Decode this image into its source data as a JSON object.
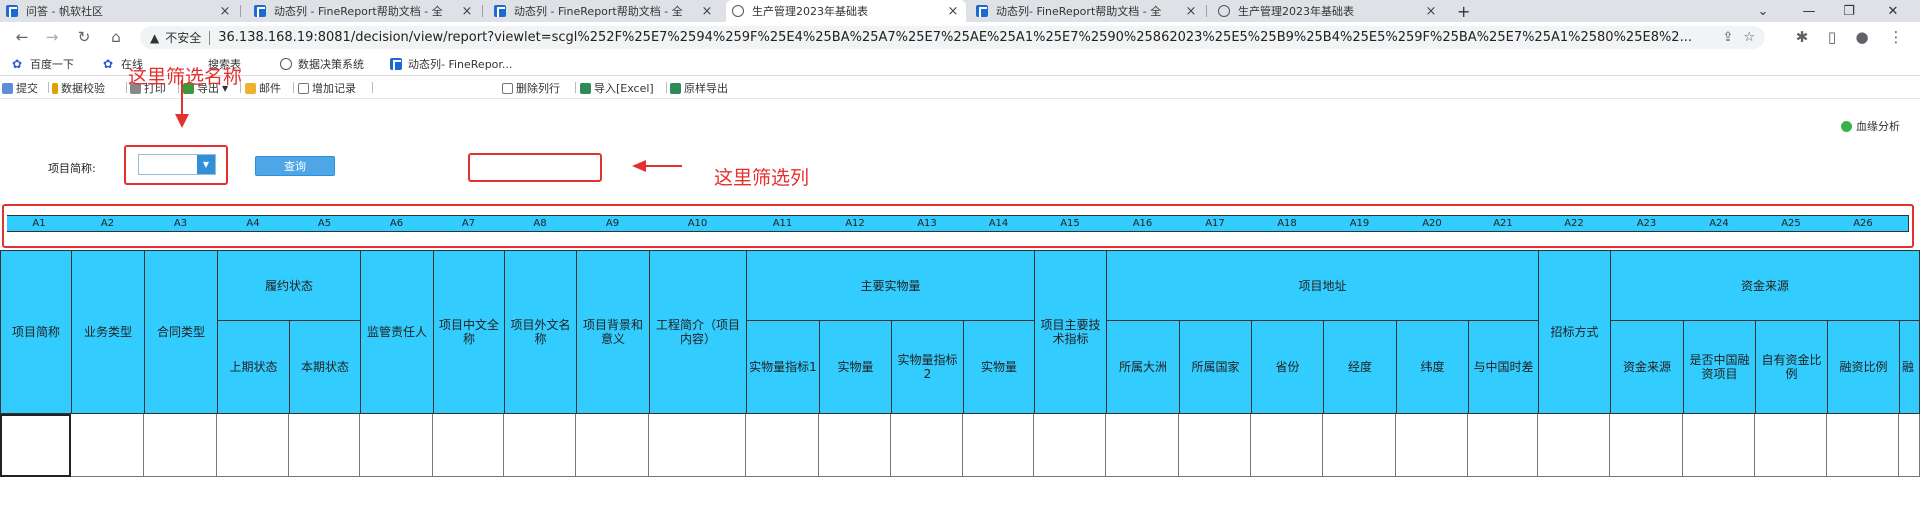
{
  "browser": {
    "tabs": [
      {
        "title": "问答 - 帆软社区",
        "icon": "finereport-icon",
        "active": false
      },
      {
        "title": "动态列 - FineReport帮助文档 - 全",
        "icon": "finereport-icon",
        "active": false
      },
      {
        "title": "动态列 - FineReport帮助文档 - 全",
        "icon": "finereport-icon",
        "active": false
      },
      {
        "title": "生产管理2023年基础表",
        "icon": "globe-icon",
        "active": true
      },
      {
        "title": "动态列- FineReport帮助文档 - 全",
        "icon": "finereport-icon",
        "active": false
      },
      {
        "title": "生产管理2023年基础表",
        "icon": "globe-icon",
        "active": false
      }
    ],
    "new_tab": "+",
    "security_label": "不安全",
    "url": "36.138.168.19:8081/decision/view/report?viewlet=scgl%252F%25E7%2594%259F%25E4%25BA%25A7%25E7%25AE%25A1%25E7%2590%25862023%25E5%25B9%25B4%25E5%259F%25BA%25E7%25A1%2580%25E8%2..."
  },
  "bookmarks": [
    {
      "label": "百度一下",
      "icon": "baidu-icon"
    },
    {
      "label": "在线",
      "icon": "baidu-icon"
    },
    {
      "label": "搜索表",
      "icon": "page-icon"
    },
    {
      "label": "数据决策系统",
      "icon": "globe-icon"
    },
    {
      "label": "动态列- FineRepor...",
      "icon": "finereport-icon"
    }
  ],
  "toolbar": {
    "items": [
      {
        "label": "提交",
        "icon": "submit-icon"
      },
      {
        "label": "数据校验",
        "icon": "validate-icon"
      },
      {
        "label": "打印",
        "icon": "print-icon"
      },
      {
        "label": "导出",
        "icon": "export-icon"
      },
      {
        "label": "邮件",
        "icon": "mail-icon"
      },
      {
        "label": "增加记录",
        "icon": "add-record-icon"
      },
      {
        "label": "删除列行",
        "icon": "delete-rows-icon"
      },
      {
        "label": "导入[Excel]",
        "icon": "import-excel-icon"
      },
      {
        "label": "原样导出",
        "icon": "export-raw-icon"
      }
    ],
    "blood_analysis": "血缘分析"
  },
  "filter": {
    "project_label": "项目简称:",
    "project_value": "",
    "query_button": "查询"
  },
  "annotations": {
    "name_filter_text": "这里筛选名称",
    "column_filter_text": "这里筛选列",
    "color": "#e53030"
  },
  "colors": {
    "header_cyan": "#33ccff",
    "query_blue": "#4ea6e6"
  },
  "column_codes": [
    "A1",
    "A2",
    "A3",
    "A4",
    "A5",
    "A6",
    "A7",
    "A8",
    "A9",
    "A10",
    "A11",
    "A12",
    "A13",
    "A14",
    "A15",
    "A16",
    "A17",
    "A18",
    "A19",
    "A20",
    "A21",
    "A22",
    "A23",
    "A24",
    "A25",
    "A26"
  ],
  "groups": {
    "performance_status": "履约状态",
    "main_quantities": "主要实物量",
    "project_address": "项目地址",
    "funding_source": "资金来源"
  },
  "headers": {
    "project_short": "项目简称",
    "business_type": "业务类型",
    "contract_type": "合同类型",
    "prev_status": "上期状态",
    "curr_status": "本期状态",
    "supervisor": "监管责任人",
    "cn_name": "项目中文全称",
    "foreign_name": "项目外文名称",
    "background": "项目背景和意义",
    "intro": "工程简介（项目内容）",
    "indicator1": "实物量指标1",
    "quantity1": "实物量",
    "indicator2": "实物量指标2",
    "quantity2": "实物量",
    "tech_index": "项目主要技术指标",
    "continent": "所属大洲",
    "country": "所属国家",
    "province": "省份",
    "longitude": "经度",
    "latitude": "纬度",
    "timezone": "与中国时差",
    "bidding": "招标方式",
    "fund_source": "资金来源",
    "cn_financing": "是否中国融资项目",
    "self_ratio": "自有资金比例",
    "finance_ratio": "融资比例",
    "partial": "融"
  }
}
